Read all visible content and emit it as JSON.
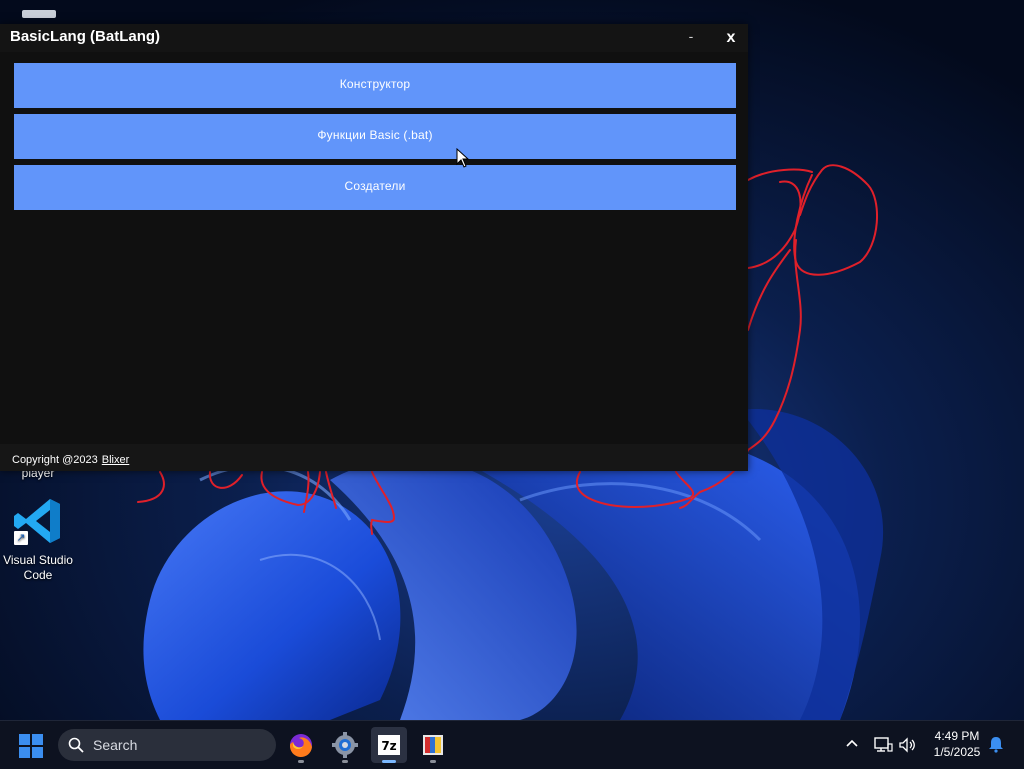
{
  "window": {
    "title": "BasicLang (BatLang)",
    "minimize_label": "-",
    "close_label": "x"
  },
  "menu": {
    "constructor_label": "Конструктор",
    "functions_label": "Функции Basic (.bat)",
    "creators_label": "Создатели"
  },
  "footer": {
    "copyright_text": "Copyright @2023",
    "author_link": "Blixer"
  },
  "desktop": {
    "icons": [
      {
        "name": "top-partial-icon",
        "label": ""
      },
      {
        "name": "player",
        "label": "player"
      },
      {
        "name": "visual-studio-code",
        "label": "Visual Studio Code",
        "label_line1": "Visual Studio",
        "label_line2": "Code"
      }
    ]
  },
  "taskbar": {
    "search_placeholder": "Search",
    "apps": [
      "firefox-icon",
      "settings-icon",
      "7zip-icon",
      "winrar-icon"
    ],
    "clock_time": "4:49 PM",
    "clock_date": "1/5/2025"
  },
  "colors": {
    "button_bg": "#6195fa",
    "window_bg": "#101010",
    "scribble": "#e0202a"
  }
}
